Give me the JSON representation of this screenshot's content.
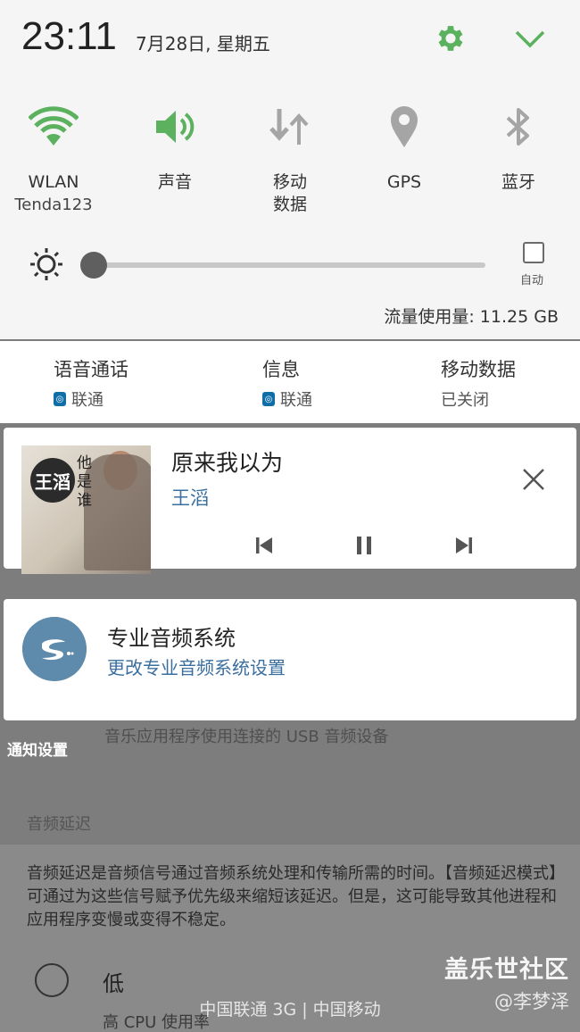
{
  "status": {
    "time": "23:11",
    "date": "7月28日, 星期五"
  },
  "quick_settings": [
    {
      "label": "WLAN",
      "sub": "Tenda123",
      "icon": "wifi-icon",
      "active": true
    },
    {
      "label": "声音",
      "sub": "",
      "icon": "volume-icon",
      "active": true
    },
    {
      "label": "移动",
      "sub": "数据",
      "icon": "mobile-data-icon",
      "active": false
    },
    {
      "label": "GPS",
      "sub": "",
      "icon": "location-icon",
      "active": false
    },
    {
      "label": "蓝牙",
      "sub": "",
      "icon": "bluetooth-icon",
      "active": false
    }
  ],
  "brightness": {
    "level": 0.0,
    "auto_label": "自动",
    "auto_checked": false
  },
  "data_usage": "流量使用量: 11.25 GB",
  "sim": [
    {
      "title": "语音通话",
      "value": "联通"
    },
    {
      "title": "信息",
      "value": "联通"
    },
    {
      "title": "移动数据",
      "value": "已关闭"
    }
  ],
  "music": {
    "album_text_big": "王滔",
    "album_text_vertical": "他是谁",
    "song": "原来我以为",
    "artist": "王滔"
  },
  "audio": {
    "title": "专业音频系统",
    "subtitle": "更改专业音频系统设置"
  },
  "background": {
    "usb_line": "音乐应用程序使用连接的 USB 音频设备",
    "notify_settings": "通知设置",
    "section_title": "音频延迟",
    "description": "音频延迟是音频信号通过音频系统处理和传输所需的时间。【音频延迟模式】可通过为这些信号赋予优先级来缩短该延迟。但是，这可能导致其他进程和应用程序变慢或变得不稳定。",
    "option_low": "低",
    "option_low_desc": "高 CPU 使用率"
  },
  "carrier": "中国联通 3G | 中国移动",
  "watermark": {
    "line1": "盖乐世社区",
    "line2": "@李梦泽"
  },
  "colors": {
    "active": "#5bb15e",
    "inactive": "#a5a5a5",
    "link": "#3a6fa0"
  }
}
